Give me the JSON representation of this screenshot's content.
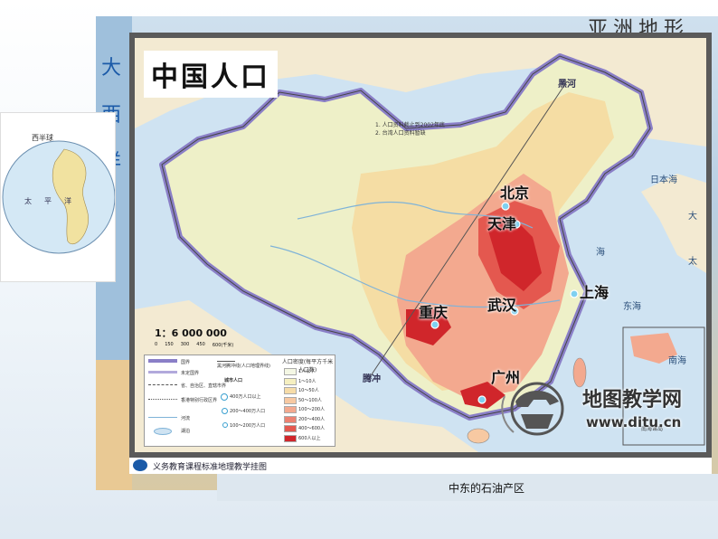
{
  "background_map": {
    "title": "亚洲地形",
    "left_chars": [
      "大",
      "西",
      "洋"
    ]
  },
  "globe": {
    "title": "西半球",
    "labels": [
      "太",
      "平",
      "洋"
    ]
  },
  "map": {
    "title": "中国人口",
    "notes": [
      "1. 人口资料截止到2002年底",
      "2. 台湾人口资料暂缺"
    ],
    "scale": "1：6 000 000",
    "scale_ticks": [
      "0",
      "150",
      "300",
      "450",
      "600(千米)"
    ],
    "line_label": "黑河腾冲线",
    "sea_labels": [
      "日本海",
      "海",
      "大",
      "东海",
      "南海",
      "太"
    ],
    "cities": {
      "beijing": "北京",
      "tianjin": "天津",
      "shanghai": "上海",
      "wuhan": "武汉",
      "chongqing": "重庆",
      "guangzhou": "广州",
      "heihe": "黑河",
      "tengchong": "腾冲"
    },
    "inset_label": "南海诸岛",
    "legend": {
      "boundaries": [
        "国界",
        "未定国界",
        "省、自治区、直辖市界",
        "香港特别行政区界",
        "河流",
        "湖泊"
      ],
      "line_items": [
        "黑河腾冲线(人口地理界线)"
      ],
      "city_title": "城市人口",
      "city_items": [
        "400万人口以上",
        "200～400万人口",
        "100～200万人口"
      ],
      "density_title": "人口密度(每平方千米人口数)",
      "density_items": [
        "1人以下",
        "1～10人",
        "10～50人",
        "50～100人",
        "100～200人",
        "200～400人",
        "400～600人",
        "600人以上"
      ],
      "density_colors": [
        "#f4f7e4",
        "#f5efc0",
        "#f6dca8",
        "#f7c9a2",
        "#f3a98f",
        "#ec8272",
        "#e4584f",
        "#d0262b"
      ]
    }
  },
  "footer": {
    "text": "义务教育课程标准地理教学挂图"
  },
  "watermark": {
    "title": "地图教学网",
    "url": "www.ditu.cn"
  },
  "caption": "中东的石油产区",
  "colors": {
    "accent_red": "#d0262b",
    "boundary_purple": "#8a7fc7",
    "sea": "#cfe3f2"
  }
}
